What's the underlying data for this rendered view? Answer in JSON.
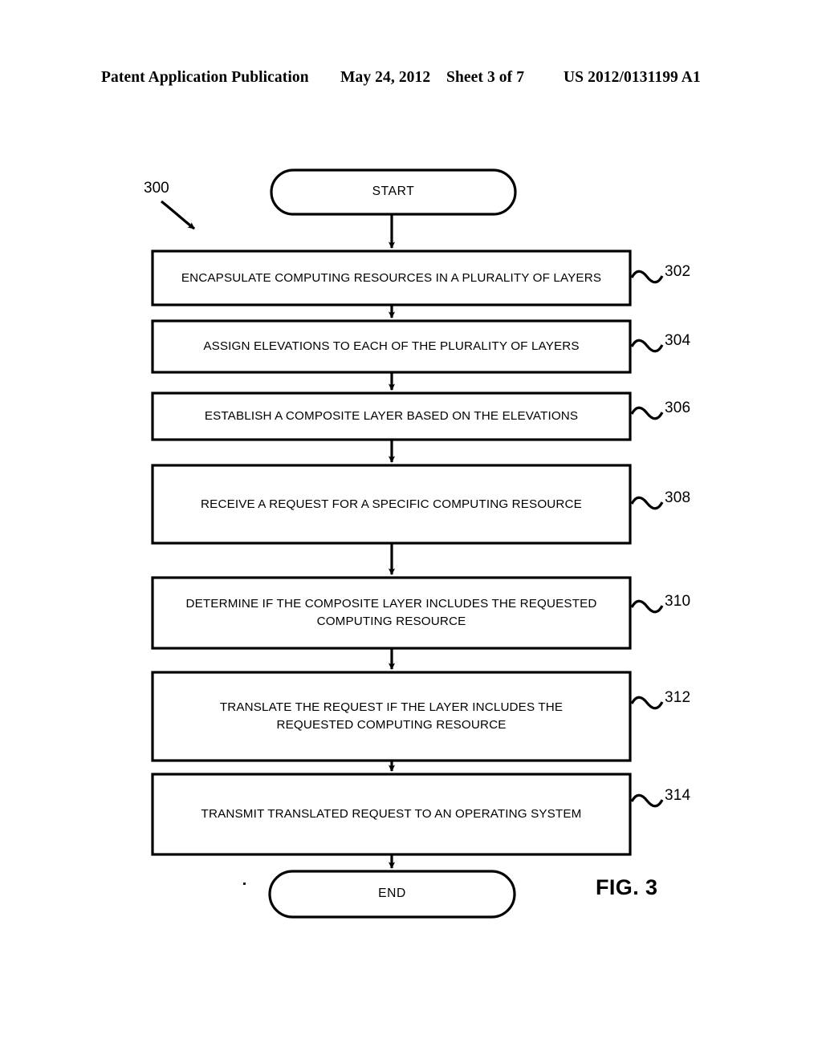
{
  "header": {
    "publication": "Patent Application Publication",
    "date": "May 24, 2012",
    "sheet": "Sheet 3 of 7",
    "patent_number": "US 2012/0131199 A1"
  },
  "figure": {
    "caption": "FIG. 3",
    "diagram_reference": "300",
    "start_label": "START",
    "end_label": "END"
  },
  "flowchart": {
    "steps": [
      {
        "ref": "302",
        "text": "ENCAPSULATE COMPUTING RESOURCES IN A PLURALITY OF LAYERS"
      },
      {
        "ref": "304",
        "text": "ASSIGN ELEVATIONS TO EACH OF THE PLURALITY OF LAYERS"
      },
      {
        "ref": "306",
        "text": "ESTABLISH A COMPOSITE LAYER BASED ON THE ELEVATIONS"
      },
      {
        "ref": "308",
        "text": "RECEIVE A REQUEST FOR A SPECIFIC COMPUTING RESOURCE"
      },
      {
        "ref": "310",
        "text": "DETERMINE IF THE COMPOSITE LAYER INCLUDES THE REQUESTED COMPUTING RESOURCE"
      },
      {
        "ref": "312",
        "text": "TRANSLATE THE REQUEST IF THE LAYER INCLUDES THE REQUESTED COMPUTING RESOURCE"
      },
      {
        "ref": "314",
        "text": "TRANSMIT TRANSLATED REQUEST TO AN OPERATING SYSTEM"
      }
    ]
  },
  "colors": {
    "ink": "#000000",
    "paper": "#ffffff"
  }
}
